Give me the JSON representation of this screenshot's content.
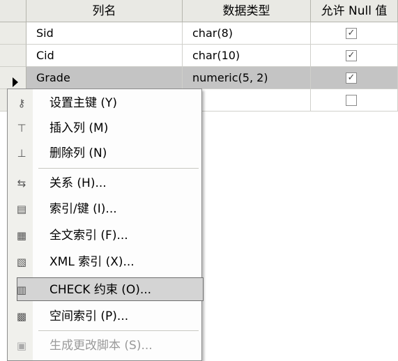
{
  "grid": {
    "columns": [
      "列名",
      "数据类型",
      "允许 Null 值"
    ],
    "rows": [
      {
        "name": "Sid",
        "type": "char(8)",
        "allow_null": true,
        "check": "✓"
      },
      {
        "name": "Cid",
        "type": "char(10)",
        "allow_null": true,
        "check": "✓"
      },
      {
        "name": "Grade",
        "type": "numeric(5, 2)",
        "allow_null": true,
        "check": "✓",
        "selected": true
      },
      {
        "name": "",
        "type": "",
        "allow_null": false,
        "check": ""
      }
    ]
  },
  "context_menu": {
    "items": [
      {
        "label": "设置主键 (Y)",
        "icon": "key-icon",
        "glyph": "⚷"
      },
      {
        "label": "插入列 (M)",
        "icon": "insert-column-icon",
        "glyph": "⊤"
      },
      {
        "label": "删除列 (N)",
        "icon": "delete-column-icon",
        "glyph": "⊥"
      },
      {
        "label": "关系 (H)...",
        "icon": "relationships-icon",
        "glyph": "⇆"
      },
      {
        "label": "索引/键 (I)...",
        "icon": "index-key-icon",
        "glyph": "▤"
      },
      {
        "label": "全文索引 (F)...",
        "icon": "fulltext-index-icon",
        "glyph": "▦"
      },
      {
        "label": "XML 索引 (X)...",
        "icon": "xml-index-icon",
        "glyph": "▧"
      },
      {
        "label": "CHECK 约束 (O)...",
        "icon": "check-constraint-icon",
        "glyph": "▥",
        "highlighted": true
      },
      {
        "label": "空间索引 (P)...",
        "icon": "spatial-index-icon",
        "glyph": "▩"
      },
      {
        "label": "生成更改脚本 (S)...",
        "icon": "generate-script-icon",
        "glyph": "▣",
        "disabled": true
      }
    ]
  }
}
